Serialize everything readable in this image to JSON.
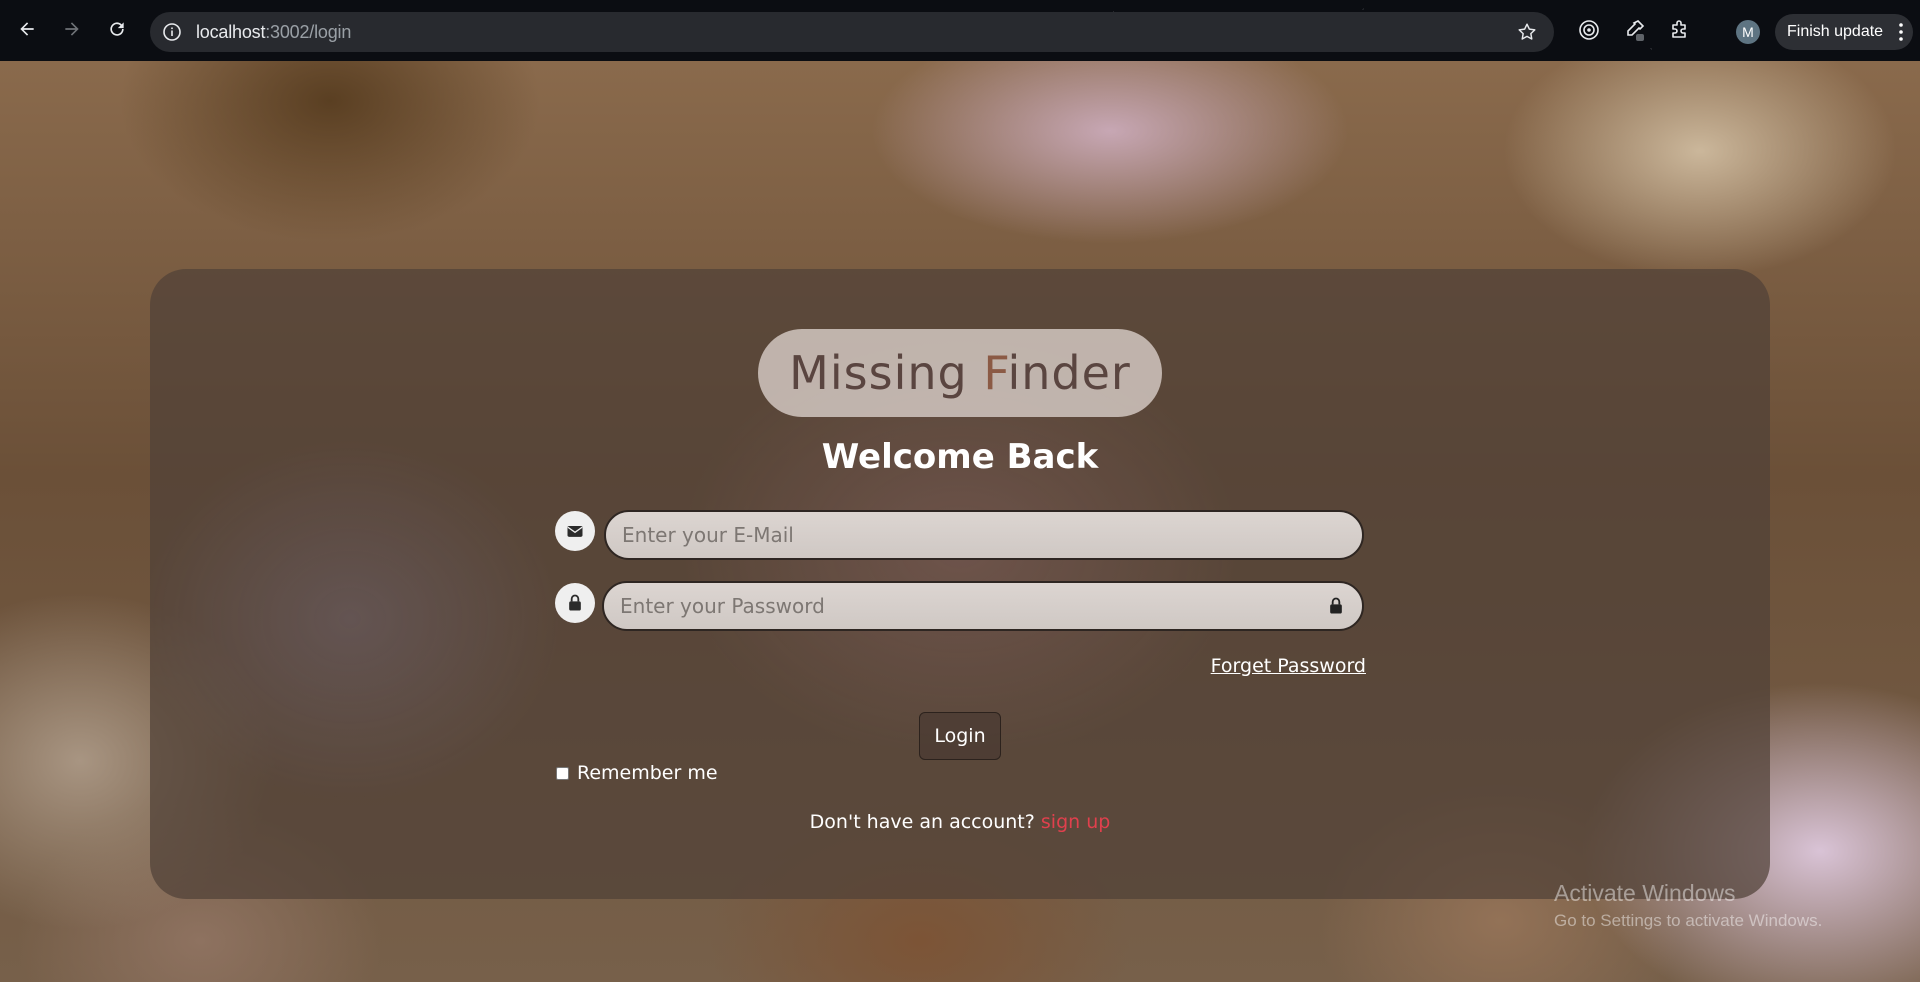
{
  "browser": {
    "url_host": "localhost",
    "url_rest": ":3002/login",
    "profile_initial": "M",
    "finish_update_label": "Finish update"
  },
  "logo": {
    "word1": "Missing",
    "word2_first": "F",
    "word2_rest": "inder"
  },
  "login": {
    "heading": "Welcome Back",
    "email_placeholder": "Enter your E-Mail",
    "password_placeholder": "Enter your Password",
    "forget_password": "Forget Password",
    "login_button": "Login",
    "remember_me": "Remember me",
    "no_account_text": "Don't have an account?",
    "signup_link": "sign up"
  },
  "watermark": {
    "line1": "Activate Windows",
    "line2": "Go to Settings to activate Windows."
  },
  "icons": {
    "email": "envelope-icon",
    "password": "lock-icon"
  },
  "colors": {
    "signup_link": "#e0404d",
    "card_bg": "rgba(80,65,55,0.72)"
  }
}
